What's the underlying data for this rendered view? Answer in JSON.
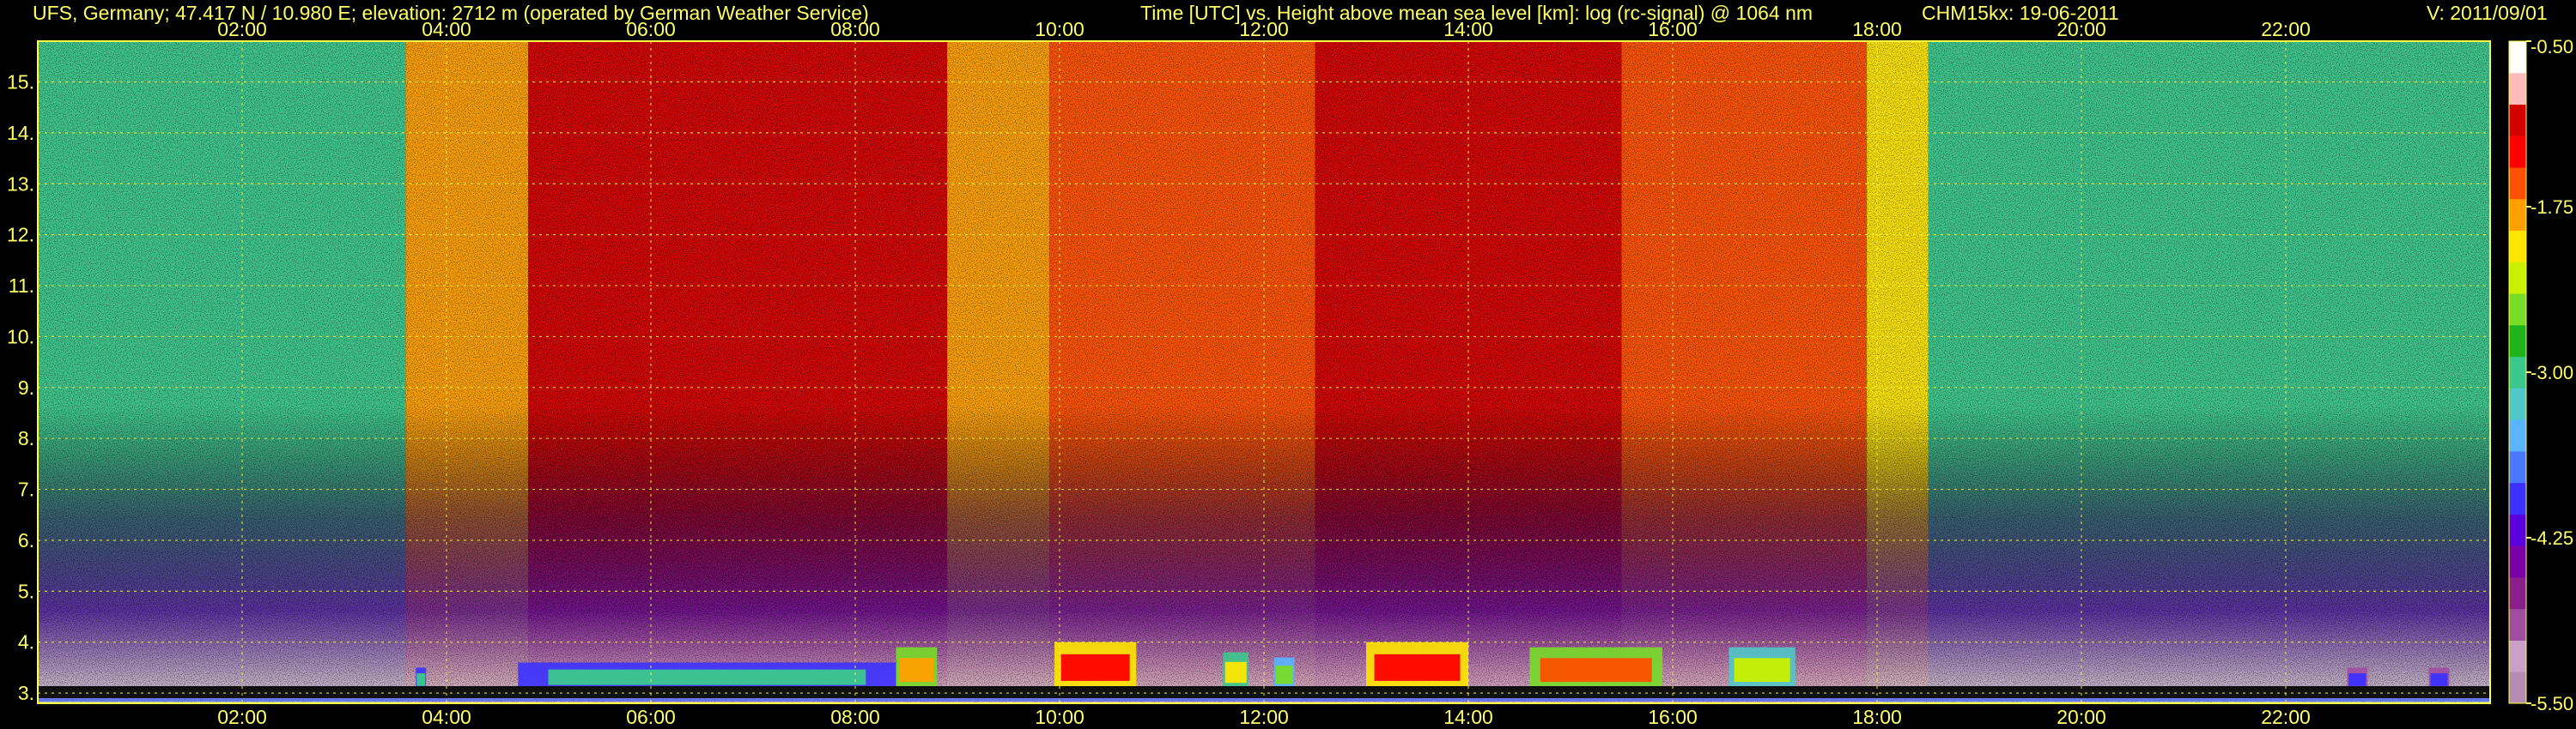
{
  "header": {
    "station": "UFS, Germany; 47.417 N / 10.980 E; elevation: 2712 m  (operated by German Weather Service)",
    "plot_title": "Time [UTC] vs. Height above mean sea level [km]: log (rc-signal) @ 1064 nm",
    "instrument": "CHM15kx: 19-06-2011",
    "version": "V: 2011/09/01"
  },
  "chart_data": {
    "type": "heatmap",
    "title": "Time [UTC] vs. Height above mean sea level [km]: log (rc-signal) @ 1064 nm",
    "x_unit": "hours UTC",
    "xlim": [
      0,
      24
    ],
    "x_ticks": [
      {
        "value": 2,
        "label": "02:00"
      },
      {
        "value": 4,
        "label": "04:00"
      },
      {
        "value": 6,
        "label": "06:00"
      },
      {
        "value": 8,
        "label": "08:00"
      },
      {
        "value": 10,
        "label": "10:00"
      },
      {
        "value": 12,
        "label": "12:00"
      },
      {
        "value": 14,
        "label": "14:00"
      },
      {
        "value": 16,
        "label": "16:00"
      },
      {
        "value": 18,
        "label": "18:00"
      },
      {
        "value": 20,
        "label": "20:00"
      },
      {
        "value": 22,
        "label": "22:00"
      }
    ],
    "y_unit": "km",
    "ylim": [
      2.8,
      15.8
    ],
    "y_ticks": [
      {
        "value": 3,
        "label": "3."
      },
      {
        "value": 4,
        "label": "4."
      },
      {
        "value": 5,
        "label": "5."
      },
      {
        "value": 6,
        "label": "6."
      },
      {
        "value": 7,
        "label": "7."
      },
      {
        "value": 8,
        "label": "8."
      },
      {
        "value": 9,
        "label": "9."
      },
      {
        "value": 10,
        "label": "10."
      },
      {
        "value": 11,
        "label": "11."
      },
      {
        "value": 12,
        "label": "12."
      },
      {
        "value": 13,
        "label": "13."
      },
      {
        "value": 14,
        "label": "14."
      },
      {
        "value": 15,
        "label": "15."
      }
    ],
    "grid": true,
    "colorbar": {
      "range": [
        -5.5,
        -0.5
      ],
      "ticks": [
        {
          "value": -0.5,
          "label": "-0.50"
        },
        {
          "value": -1.75,
          "label": "-1.75"
        },
        {
          "value": -3.0,
          "label": "-3.00"
        },
        {
          "value": -4.25,
          "label": "-4.25"
        },
        {
          "value": -5.5,
          "label": "-5.50"
        }
      ],
      "colors": [
        "#b48cb4",
        "#c8a0c8",
        "#a04ea0",
        "#8a1e8a",
        "#7a00aa",
        "#5a00dd",
        "#3c32ff",
        "#4b78ff",
        "#5ab4ff",
        "#50c8c8",
        "#3cc88c",
        "#1eb41e",
        "#78dc28",
        "#c8f000",
        "#ffe600",
        "#ffa000",
        "#ff5000",
        "#ff0000",
        "#d40000",
        "#ffbbbb",
        "#ffffff"
      ]
    },
    "noise_background_log": [
      {
        "start": 0.0,
        "end": 3.6,
        "value": -2.9
      },
      {
        "start": 3.6,
        "end": 4.8,
        "value": -1.7
      },
      {
        "start": 4.8,
        "end": 8.9,
        "value": -1.0
      },
      {
        "start": 8.9,
        "end": 9.9,
        "value": -1.8
      },
      {
        "start": 9.9,
        "end": 12.5,
        "value": -1.5
      },
      {
        "start": 12.5,
        "end": 15.5,
        "value": -1.1
      },
      {
        "start": 15.5,
        "end": 17.9,
        "value": -1.5
      },
      {
        "start": 17.9,
        "end": 18.5,
        "value": -2.0
      },
      {
        "start": 18.5,
        "end": 24.0,
        "value": -2.9
      }
    ],
    "boundary_layer_features": [
      {
        "start": 3.7,
        "end": 3.8,
        "top": 3.5,
        "value": -3.0
      },
      {
        "start": 4.7,
        "end": 8.4,
        "top": 3.6,
        "value": -3.0
      },
      {
        "start": 8.4,
        "end": 8.8,
        "top": 3.9,
        "value": -1.7
      },
      {
        "start": 9.95,
        "end": 10.75,
        "top": 4.0,
        "value": -1.2
      },
      {
        "start": 11.6,
        "end": 11.85,
        "top": 3.8,
        "value": -2.0
      },
      {
        "start": 12.1,
        "end": 12.3,
        "top": 3.7,
        "value": -2.6
      },
      {
        "start": 13.0,
        "end": 14.0,
        "top": 4.0,
        "value": -1.2
      },
      {
        "start": 14.6,
        "end": 15.9,
        "top": 3.9,
        "value": -1.5
      },
      {
        "start": 16.55,
        "end": 17.2,
        "top": 3.9,
        "value": -2.3
      },
      {
        "start": 22.6,
        "end": 22.8,
        "top": 3.5,
        "value": -4.0
      },
      {
        "start": 23.4,
        "end": 23.6,
        "top": 3.5,
        "value": -4.0
      }
    ]
  }
}
